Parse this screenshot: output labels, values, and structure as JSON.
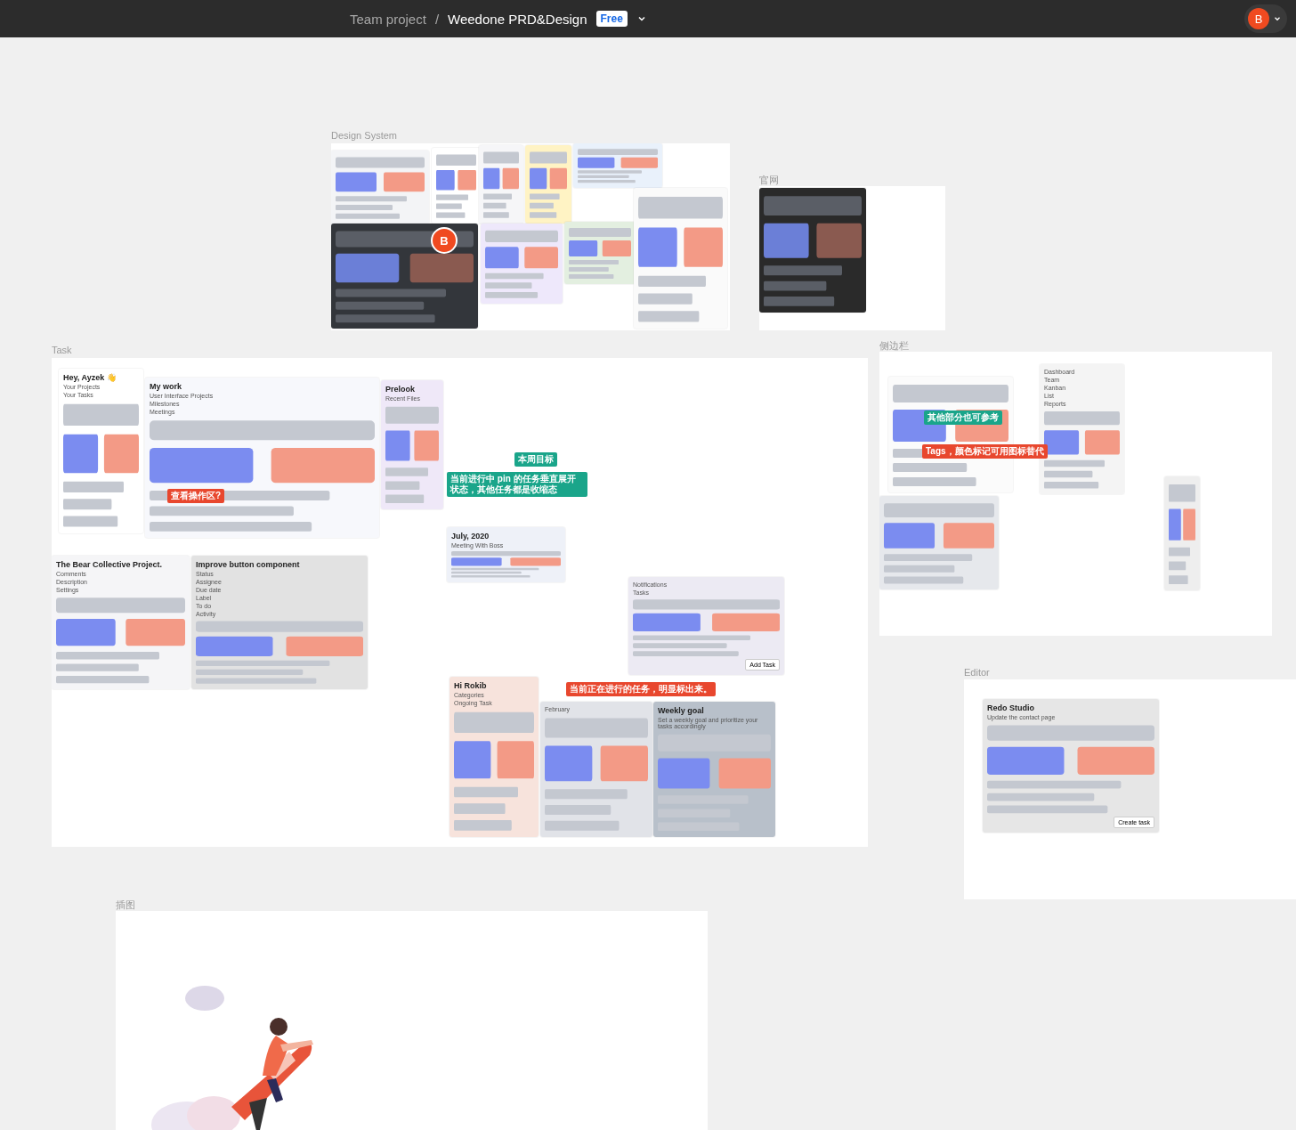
{
  "topbar": {
    "team": "Team project",
    "separator": "/",
    "file": "Weedone PRD&Design",
    "badge": "Free",
    "avatar": "B"
  },
  "frames": [
    {
      "title": "Design System",
      "cursor": "B",
      "shots": [
        {
          "kind": "screen"
        },
        {
          "kind": "screen"
        },
        {
          "kind": "screen"
        },
        {
          "kind": "screen"
        },
        {
          "kind": "screen"
        },
        {
          "kind": "screen"
        },
        {
          "kind": "screen"
        },
        {
          "kind": "screen"
        },
        {
          "kind": "screen"
        }
      ]
    },
    {
      "title": "官网",
      "shots": [
        {
          "kind": "screen"
        }
      ]
    },
    {
      "title": "Task",
      "shots": [
        {
          "kind": "screen",
          "heading": "Hey, Ayzek 👋",
          "lines": [
            "Your Projects",
            "Your Tasks"
          ]
        },
        {
          "kind": "screen",
          "heading": "My work",
          "lines": [
            "User Interface Projects",
            "Milestones",
            "Meetings"
          ]
        },
        {
          "kind": "screen",
          "heading": "Prelook",
          "lines": [
            "Recent Files"
          ]
        },
        {
          "kind": "screen",
          "heading": "July, 2020",
          "lines": [
            "Meeting With Boss"
          ]
        },
        {
          "kind": "screen",
          "heading": "The Bear Collective Project.",
          "lines": [
            "Comments",
            "Description",
            "Settings"
          ]
        },
        {
          "kind": "screen",
          "heading": "Improve button component",
          "lines": [
            "Status",
            "Assignee",
            "Due date",
            "Label",
            "To do",
            "Activity"
          ]
        },
        {
          "kind": "screen",
          "lines": [
            "Notifications",
            "Tasks"
          ],
          "button": "Add Task"
        },
        {
          "kind": "screen",
          "heading": "Hi Rokib",
          "lines": [
            "Categories",
            "Ongoing Task"
          ]
        },
        {
          "kind": "screen",
          "lines": [
            "February"
          ]
        },
        {
          "kind": "screen",
          "heading": "Weekly goal",
          "lines": [
            "Set a weekly goal and prioritize your tasks accordingly"
          ]
        }
      ],
      "notes": [
        {
          "text": "查看操作区?",
          "color": "#e8472e"
        },
        {
          "text": "当前进行中 pin 的任务垂直展开状态，其他任务都是收缩态",
          "color": "#1aa58a"
        },
        {
          "text": "本周目标",
          "color": "#1aa58a"
        },
        {
          "text": "当前正在进行的任务，明显标出来。",
          "color": "#e8472e"
        }
      ]
    },
    {
      "title": "侧边栏",
      "shots": [
        {
          "kind": "screen"
        },
        {
          "kind": "screen",
          "lines": [
            "Dashboard",
            "Team",
            "Kanban",
            "List",
            "Reports"
          ]
        },
        {
          "kind": "screen"
        },
        {
          "kind": "screen"
        }
      ],
      "notes": [
        {
          "text": "其他部分也可参考",
          "color": "#1aa58a"
        },
        {
          "text": "Tags，颜色标记可用图标替代",
          "color": "#e8472e"
        }
      ]
    },
    {
      "title": "Editor",
      "shots": [
        {
          "kind": "screen",
          "heading": "Redo Studio",
          "lines": [
            "Update the contact page"
          ],
          "button": "Create task"
        }
      ]
    },
    {
      "title": "插图"
    }
  ]
}
